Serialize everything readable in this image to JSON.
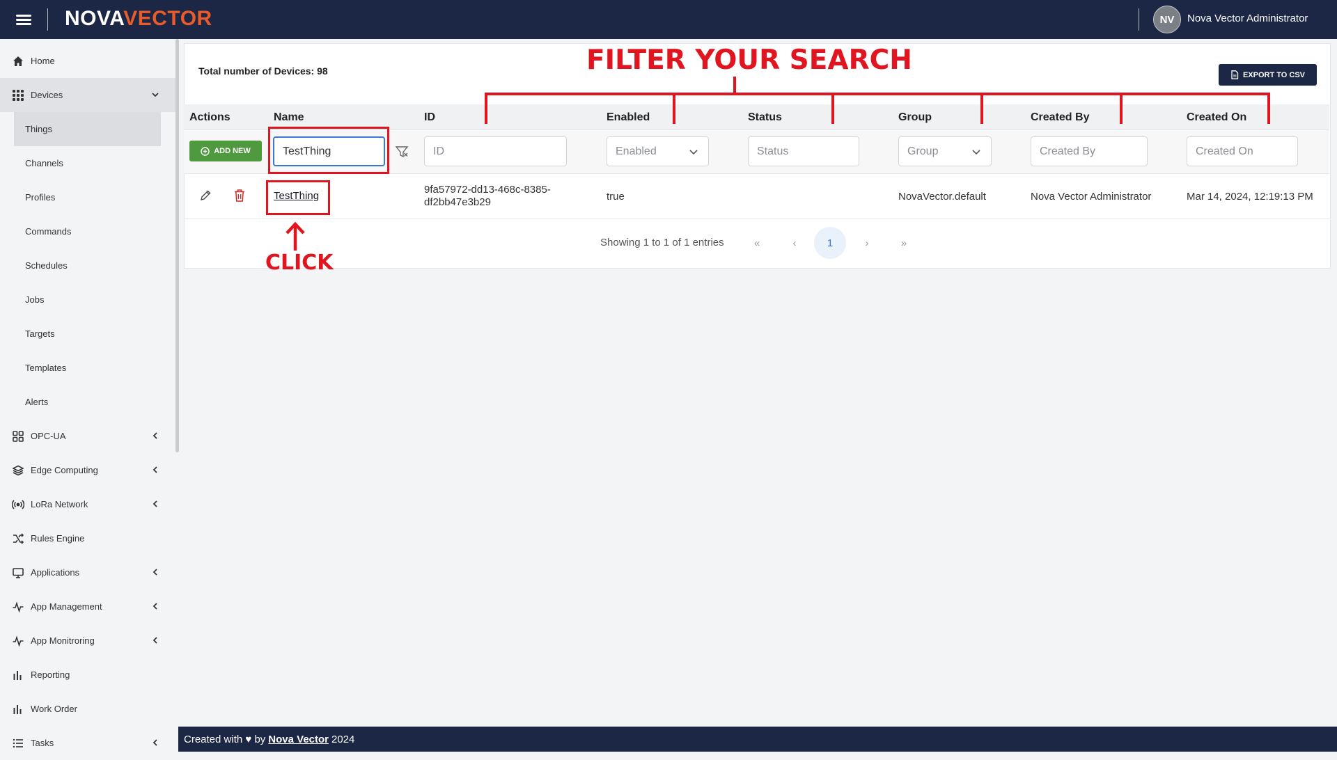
{
  "brand": {
    "part1": "NOVA",
    "part2": "VECTOR"
  },
  "user": {
    "initials": "NV",
    "name": "Nova Vector Administrator"
  },
  "sidebar": {
    "items": [
      {
        "label": "Home",
        "icon": "home-icon"
      },
      {
        "label": "Devices",
        "icon": "grid-dots-icon"
      },
      {
        "label": "OPC-UA",
        "icon": "squares-icon"
      },
      {
        "label": "Edge Computing",
        "icon": "stack-icon"
      },
      {
        "label": "LoRa Network",
        "icon": "signal-icon"
      },
      {
        "label": "Rules Engine",
        "icon": "shuffle-icon"
      },
      {
        "label": "Applications",
        "icon": "monitor-icon"
      },
      {
        "label": "App Management",
        "icon": "pulse-icon"
      },
      {
        "label": "App Monitroring",
        "icon": "pulse-icon"
      },
      {
        "label": "Reporting",
        "icon": "bar-chart-icon"
      },
      {
        "label": "Work Order",
        "icon": "bar-chart-icon"
      },
      {
        "label": "Tasks",
        "icon": "list-icon"
      }
    ],
    "devices_sub": [
      "Things",
      "Channels",
      "Profiles",
      "Commands",
      "Schedules",
      "Jobs",
      "Targets",
      "Templates",
      "Alerts"
    ]
  },
  "main": {
    "total_label": "Total number of Devices: 98",
    "export_label": "EXPORT TO CSV",
    "add_label": "ADD NEW",
    "columns": [
      "Actions",
      "Name",
      "ID",
      "Enabled",
      "Status",
      "Group",
      "Created By",
      "Created On"
    ],
    "filters": {
      "name_value": "TestThing",
      "id_placeholder": "ID",
      "enabled_placeholder": "Enabled",
      "status_placeholder": "Status",
      "group_placeholder": "Group",
      "created_by_placeholder": "Created By",
      "created_on_placeholder": "Created On"
    },
    "row": {
      "name": "TestThing",
      "id_line1": "9fa57972-dd13-468c-8385-",
      "id_line2": "df2bb47e3b29",
      "enabled": "true",
      "status": "",
      "group": "NovaVector.default",
      "created_by": "Nova Vector Administrator",
      "created_on": "Mar 14, 2024, 12:19:13 PM"
    },
    "pager": {
      "text": "Showing 1 to 1 of 1 entries",
      "first": "«",
      "prev": "‹",
      "current": "1",
      "next": "›",
      "last": "»"
    }
  },
  "annotations": {
    "filter_title": "FILTER YOUR SEARCH",
    "click_label": "CLICK"
  },
  "footer": {
    "prefix": "Created with ♥ by",
    "link": "Nova Vector",
    "suffix": "2024"
  },
  "colors": {
    "navy": "#1c2645",
    "brand_accent": "#e85b2a",
    "annotation_red": "#e0151f",
    "add_green": "#4f9a3e"
  }
}
